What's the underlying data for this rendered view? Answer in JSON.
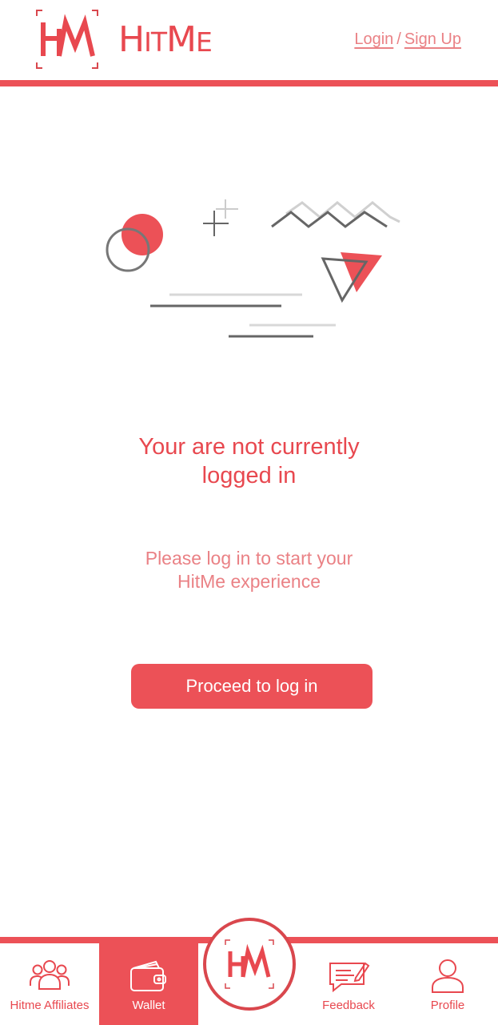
{
  "header": {
    "brand_big_h": "H",
    "brand_small_it": "IT",
    "brand_big_m": "M",
    "brand_small_e": "E",
    "login_label": "Login",
    "separator": "/",
    "signup_label": "Sign Up"
  },
  "main": {
    "title": "Your are not currently logged in",
    "subtitle": "Please log in to start your HitMe experience",
    "cta_label": "Proceed to log in"
  },
  "tabbar": {
    "items": [
      {
        "label": "Hitme Affiliates",
        "icon": "group-icon",
        "active": false
      },
      {
        "label": "Wallet",
        "icon": "wallet-icon",
        "active": true
      },
      {
        "label": "Feedback",
        "icon": "chat-icon",
        "active": false
      },
      {
        "label": "Profile",
        "icon": "user-icon",
        "active": false
      }
    ],
    "center_icon": "hitme-logo-icon"
  },
  "colors": {
    "accent": "#ec5157",
    "text_primary": "#e8484f",
    "text_secondary": "#ea8185"
  }
}
